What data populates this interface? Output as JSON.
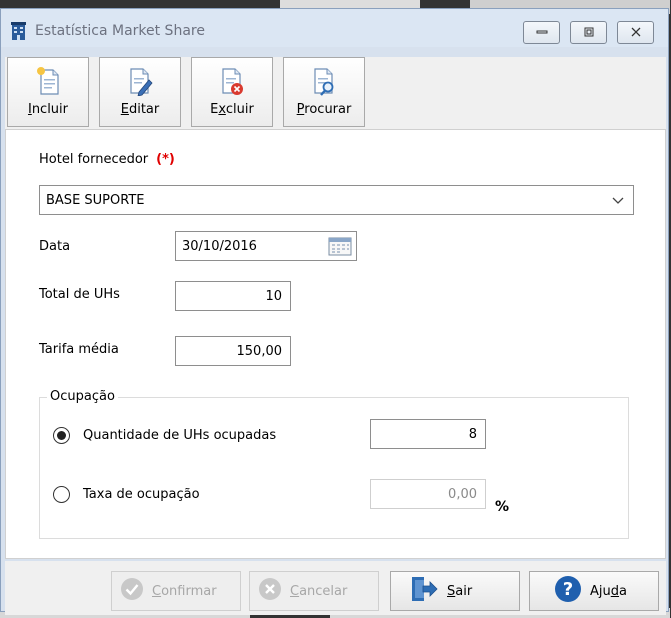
{
  "window": {
    "title": "Estatística Market Share"
  },
  "toolbar": {
    "incluir": {
      "pre": "",
      "key": "I",
      "rest": "ncluir"
    },
    "editar": {
      "pre": "",
      "key": "E",
      "rest": "ditar"
    },
    "excluir": {
      "pre": "E",
      "key": "x",
      "rest": "cluir"
    },
    "procurar": {
      "pre": "",
      "key": "P",
      "rest": "rocurar"
    }
  },
  "form": {
    "hotel_label": "Hotel fornecedor",
    "required_mark": "(*)",
    "hotel_value": "BASE SUPORTE",
    "data_label": "Data",
    "data_value": "30/10/2016",
    "total_label": "Total de UHs",
    "total_value": "10",
    "tarifa_label": "Tarifa média",
    "tarifa_value": "150,00",
    "ocupacao_title": "Ocupação",
    "qtd_label": "Quantidade de UHs ocupadas",
    "qtd_value": "8",
    "qtd_selected": true,
    "taxa_label": "Taxa de ocupação",
    "taxa_value": "0,00",
    "percent_symbol": "%"
  },
  "buttons": {
    "confirmar": {
      "pre": "",
      "key": "C",
      "rest": "onfirmar"
    },
    "cancelar": {
      "pre": "",
      "key": "C",
      "rest": "ancelar"
    },
    "sair": {
      "pre": "",
      "key": "S",
      "rest": "air"
    },
    "ajuda": {
      "pre": "Aju",
      "key": "d",
      "rest": "a"
    }
  },
  "icons": {
    "app": "hotel-building-icon",
    "incluir": "document-new-icon",
    "editar": "document-edit-icon",
    "excluir": "document-delete-icon",
    "procurar": "document-search-icon",
    "confirmar": "check-circle-icon",
    "cancelar": "x-circle-icon",
    "sair": "exit-door-icon",
    "ajuda": "help-icon"
  },
  "colors": {
    "required": "#e00000",
    "help_blue": "#1f5fae",
    "exit_blue": "#2e6db4"
  }
}
